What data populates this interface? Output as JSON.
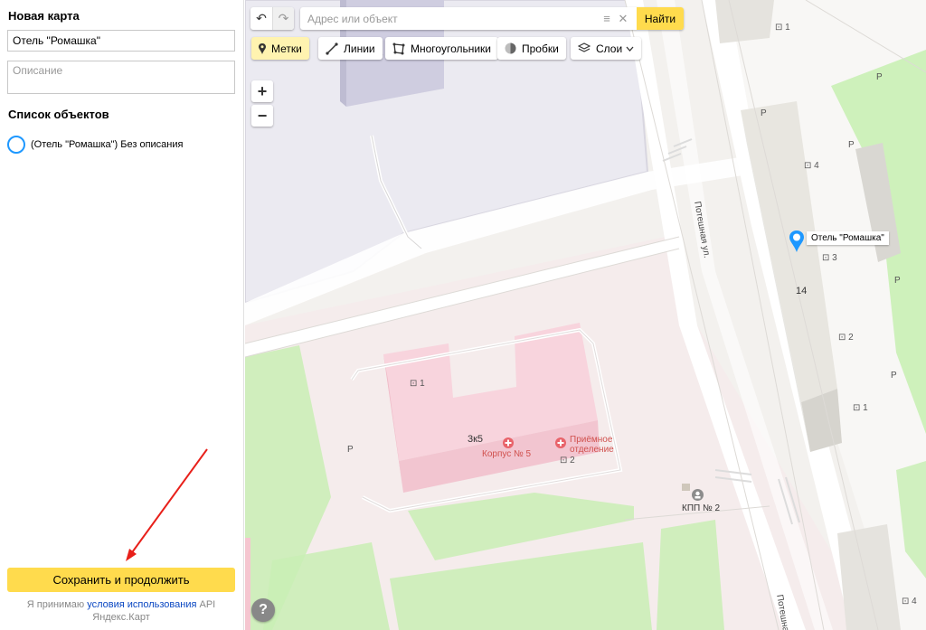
{
  "panel": {
    "title": "Новая карта",
    "name_value": "Отель \"Ромашка\"",
    "description_placeholder": "Описание",
    "list_title": "Список объектов",
    "items": [
      {
        "label": "(Отель \"Ромашка\") Без описания"
      }
    ],
    "save_label": "Сохранить и продолжить",
    "terms_prefix": "Я принимаю ",
    "terms_link": "условия использования",
    "terms_suffix": " API Яндекс.Карт"
  },
  "toolbar": {
    "search_placeholder": "Адрес или объект",
    "search_button": "Найти",
    "tools": {
      "marks": "Метки",
      "lines": "Линии",
      "polygons": "Многоугольники",
      "traffic": "Пробки",
      "layers": "Слои"
    },
    "active_tool": "marks"
  },
  "map": {
    "placemark_label": "Отель \"Ромашка\"",
    "labels": {
      "b_5": "5",
      "b_1_top": "1",
      "b_p1": "P",
      "b_p2": "P",
      "b_p3": "P",
      "b_4": "4",
      "b_3": "3",
      "b_14": "14",
      "b_2_right": "2",
      "b_p4": "P",
      "b_1_right": "1",
      "b_p5": "P",
      "b_1_pink": "1",
      "b_3k5": "3к5",
      "korpus": "Корпус № 5",
      "priemnoe": "Приёмное отделение",
      "b_2_pink": "2",
      "b_p6": "P",
      "kpp": "КПП № 2",
      "b_4_bottom": "4",
      "street1": "Потешная ул.",
      "street2": "Потешная"
    }
  },
  "colors": {
    "accent": "#ffdb4d",
    "link": "#0a47c2",
    "placemark": "#1e98ff",
    "hospital": "#f5c6d0",
    "park": "#c9efb5"
  }
}
